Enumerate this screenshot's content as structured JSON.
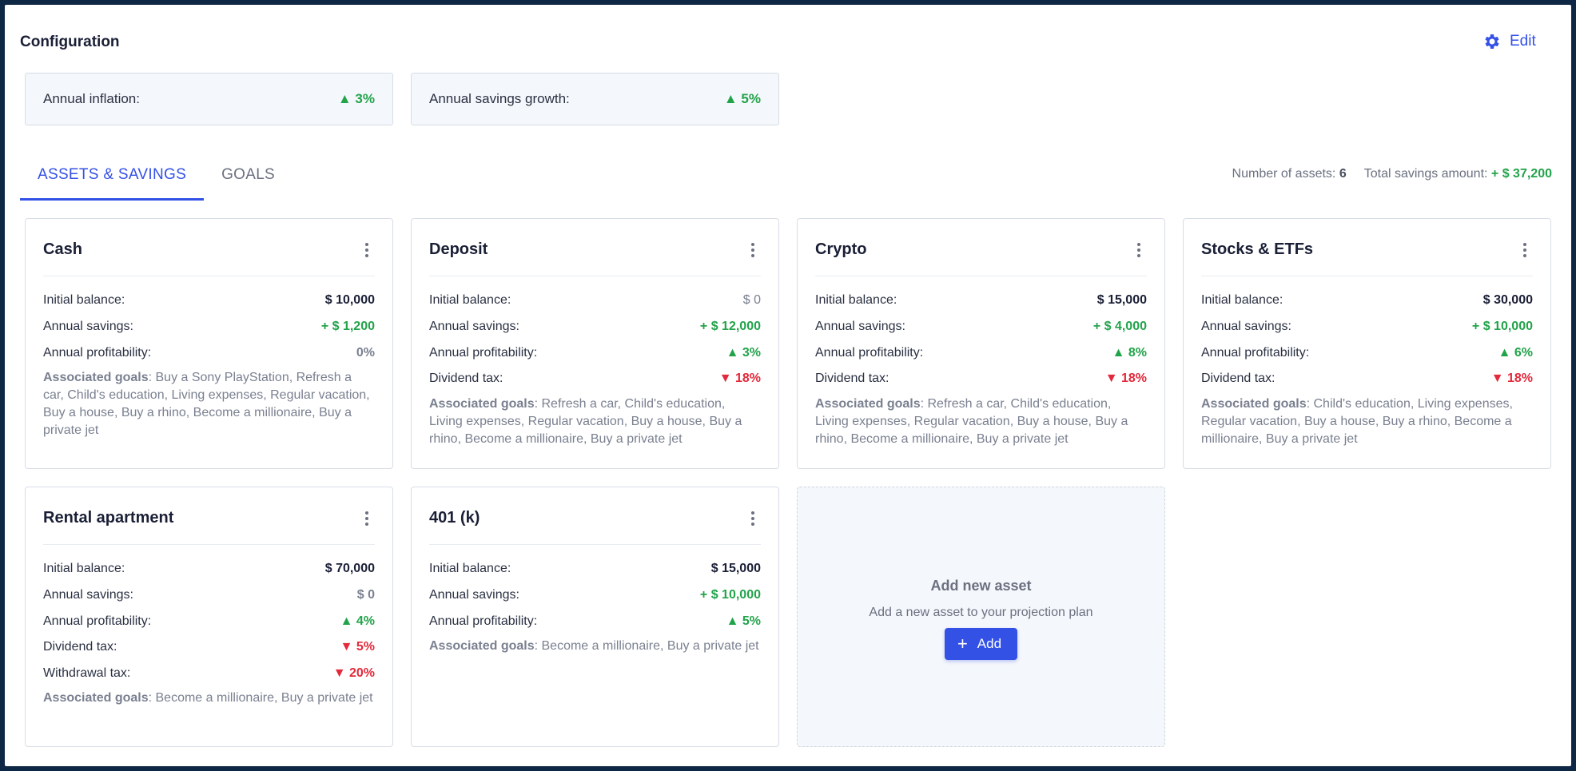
{
  "config": {
    "title": "Configuration",
    "edit_label": "Edit",
    "inflation_label": "Annual inflation:",
    "inflation_value": "▲ 3%",
    "growth_label": "Annual savings growth:",
    "growth_value": "▲ 5%"
  },
  "tabs": [
    {
      "label": "ASSETS & SAVINGS"
    },
    {
      "label": "GOALS"
    }
  ],
  "summary": {
    "assets_label": "Number of assets:",
    "assets_value": "6",
    "total_label": "Total savings amount:",
    "total_value": "+ $ 37,200"
  },
  "labels": {
    "initial": "Initial balance:",
    "savings": "Annual savings:",
    "profit": "Annual profitability:",
    "dividend": "Dividend tax:",
    "withdrawal": "Withdrawal tax:",
    "goals": "Associated goals"
  },
  "cards": [
    {
      "title": "Cash",
      "initial": "$ 10,000",
      "savings": "+ $ 1,200",
      "profit": "0%",
      "goals": ": Buy a Sony PlayStation, Refresh a car, Child's education, Living expenses, Regular vacation, Buy a house, Buy a rhino, Become a millionaire, Buy a private jet"
    },
    {
      "title": "Deposit",
      "initial": "$ 0",
      "savings": "+ $ 12,000",
      "profit": "▲ 3%",
      "dividend": "▼ 18%",
      "goals": ": Refresh a car, Child's education, Living expenses, Regular vacation, Buy a house, Buy a rhino, Become a millionaire, Buy a private jet"
    },
    {
      "title": "Crypto",
      "initial": "$ 15,000",
      "savings": "+ $ 4,000",
      "profit": "▲ 8%",
      "dividend": "▼ 18%",
      "goals": ": Refresh a car, Child's education, Living expenses, Regular vacation, Buy a house, Buy a rhino, Become a millionaire, Buy a private jet"
    },
    {
      "title": "Stocks & ETFs",
      "initial": "$ 30,000",
      "savings": "+ $ 10,000",
      "profit": "▲ 6%",
      "dividend": "▼ 18%",
      "goals": ": Child's education, Living expenses, Regular vacation, Buy a house, Buy a rhino, Become a millionaire, Buy a private jet"
    },
    {
      "title": "Rental apartment",
      "initial": "$ 70,000",
      "savings": "$ 0",
      "profit": "▲ 4%",
      "dividend": "▼ 5%",
      "withdrawal": "▼ 20%",
      "goals": ": Become a millionaire, Buy a private jet"
    },
    {
      "title": "401 (k)",
      "initial": "$ 15,000",
      "savings": "+ $ 10,000",
      "profit": "▲ 5%",
      "goals": ": Become a millionaire, Buy a private jet"
    }
  ],
  "add_asset": {
    "title": "Add new asset",
    "subtitle": "Add a new asset to your projection plan",
    "button_label": "Add"
  },
  "colors": {
    "accent": "#3451e6",
    "positive": "#22a34a",
    "negative": "#e3293b"
  }
}
